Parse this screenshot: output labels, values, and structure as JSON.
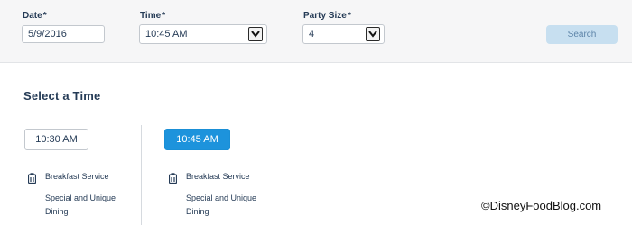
{
  "search_bar": {
    "date": {
      "label": "Date",
      "required_mark": "*",
      "value": "5/9/2016"
    },
    "time": {
      "label": "Time",
      "required_mark": "*",
      "value": "10:45 AM"
    },
    "party_size": {
      "label": "Party Size",
      "required_mark": "*",
      "value": "4"
    },
    "search_label": "Search"
  },
  "section_title": "Select a Time",
  "time_slots": [
    {
      "time": "10:30 AM",
      "selected": false,
      "service": "Breakfast Service",
      "category_line1": "Special and Unique",
      "category_line2": "Dining",
      "icon": "dining-tray-icon"
    },
    {
      "time": "10:45 AM",
      "selected": true,
      "service": "Breakfast Service",
      "category_line1": "Special and Unique",
      "category_line2": "Dining",
      "icon": "dining-tray-icon"
    }
  ],
  "colors": {
    "accent": "#1d93dc",
    "search_disabled_bg": "#c7dff0",
    "text": "#253b56"
  },
  "watermark": "©DisneyFoodBlog.com"
}
